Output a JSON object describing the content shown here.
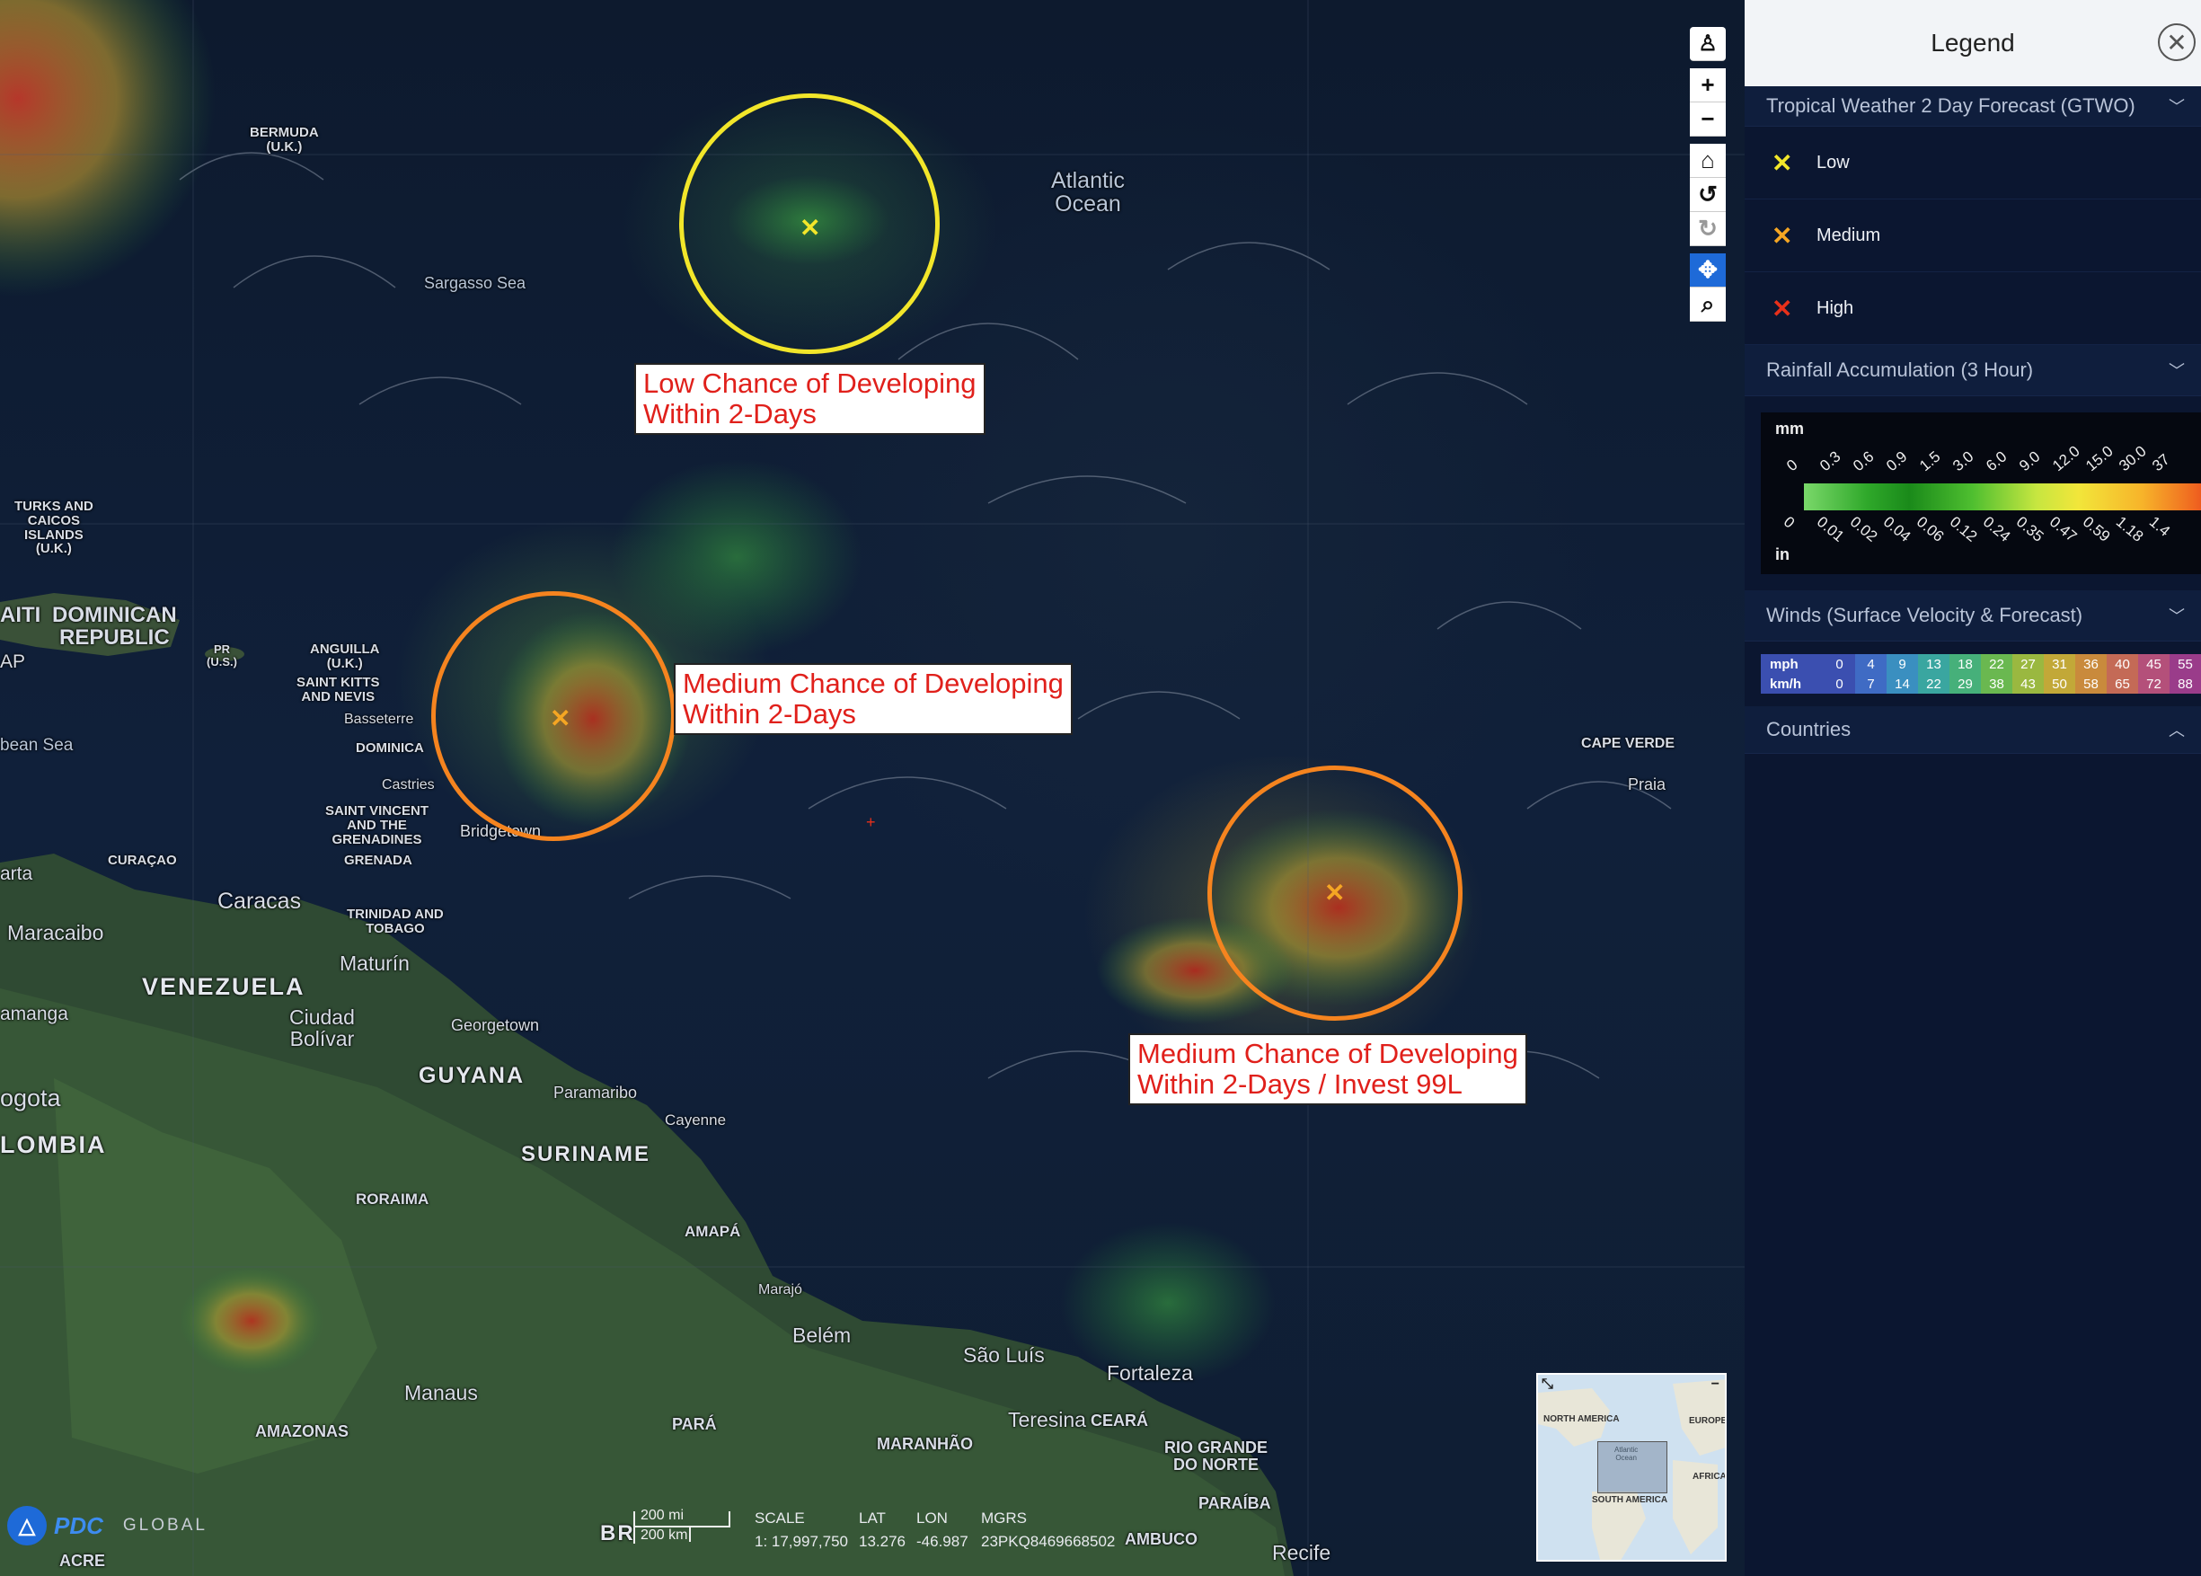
{
  "legend": {
    "title": "Legend",
    "sections": {
      "gtwo": {
        "title": "Tropical Weather 2 Day Forecast (GTWO)",
        "items": [
          {
            "label": "Low",
            "color": "#f2e62a"
          },
          {
            "label": "Medium",
            "color": "#f5a623"
          },
          {
            "label": "High",
            "color": "#e8301a"
          }
        ]
      },
      "rain": {
        "title": "Rainfall Accumulation (3 Hour)",
        "unit_top": "mm",
        "unit_bottom": "in",
        "mm_ticks": [
          "0",
          "0.3",
          "0.6",
          "0.9",
          "1.5",
          "3.0",
          "6.0",
          "9.0",
          "12.0",
          "15.0",
          "30.0",
          "37"
        ],
        "in_ticks": [
          "0",
          "0.01",
          "0.02",
          "0.04",
          "0.06",
          "0.12",
          "0.24",
          "0.35",
          "0.47",
          "0.59",
          "1.18",
          "1.4"
        ]
      },
      "winds": {
        "title": "Winds (Surface Velocity & Forecast)",
        "rows": [
          {
            "unit": "mph",
            "values": [
              "0",
              "4",
              "9",
              "13",
              "18",
              "22",
              "27",
              "31",
              "36",
              "40",
              "45",
              "55"
            ]
          },
          {
            "unit": "km/h",
            "values": [
              "0",
              "7",
              "14",
              "22",
              "29",
              "38",
              "43",
              "50",
              "58",
              "65",
              "72",
              "88"
            ]
          }
        ],
        "colors": [
          "#3b4fb0",
          "#3f6bc4",
          "#3a8fc0",
          "#3aa6a0",
          "#46b07a",
          "#6ab850",
          "#9ab840",
          "#c2a838",
          "#c98a3c",
          "#c46a56",
          "#b4507a",
          "#9a3c8a"
        ]
      },
      "countries": {
        "title": "Countries"
      }
    }
  },
  "callouts": [
    {
      "line1": "Low Chance of Developing",
      "line2": "Within 2-Days"
    },
    {
      "line1": "Medium Chance of Developing",
      "line2": "Within 2-Days"
    },
    {
      "line1": "Medium Chance of Developing",
      "line2": "Within 2-Days / Invest 99L"
    }
  ],
  "places": {
    "bermuda": "BERMUDA\n(U.K.)",
    "sargasso": "Sargasso Sea",
    "atlantic": "Atlantic\nOcean",
    "turks": "TURKS AND\nCAICOS\nISLANDS\n(U.K.)",
    "dominican": "DOMINICAN\nREPUBLIC",
    "aiti": "AITI",
    "pr": "PR\n(U.S.)",
    "ap": "AP",
    "anguilla": "ANGUILLA\n(U.K.)",
    "stkitts": "SAINT KITTS\nAND NEVIS",
    "basseterre": "Basseterre",
    "dominica": "DOMINICA",
    "castries": "Castries",
    "stvincent": "SAINT VINCENT\nAND THE\nGRENADINES",
    "grenada": "GRENADA",
    "bridgetown": "Bridgetown",
    "bean_sea": "bean Sea",
    "curacao": "CURAÇAO",
    "arta": "arta",
    "caracas": "Caracas",
    "maracaibo": "Maracaibo",
    "trinidad": "TRINIDAD AND\nTOBAGO",
    "maturin": "Maturín",
    "venezuela": "VENEZUELA",
    "amanga": "amanga",
    "ciudad": "Ciudad\nBolívar",
    "georgetown": "Georgetown",
    "guyana": "GUYANA",
    "paramaribo": "Paramaribo",
    "cayenne": "Cayenne",
    "ogota": "ogota",
    "olombia": "LOMBIA",
    "suriname": "SURINAME",
    "roraima": "RORAIMA",
    "amapa": "AMAPÁ",
    "marajo": "Marajó",
    "belem": "Belém",
    "saoluis": "São Luís",
    "fortaleza": "Fortaleza",
    "manaus": "Manaus",
    "amazonas": "AMAZONAS",
    "para": "PARÁ",
    "maranhao": "MARANHÃO",
    "teresina": "Teresina",
    "ceara": "CEARÁ",
    "riogrande": "RIO GRANDE\nDO NORTE",
    "paraiba": "PARAÍBA",
    "ambuco": "AMBUCO",
    "recife": "Recife",
    "acre": "ACRE",
    "br": "BR",
    "capeverde": "CAPE VERDE",
    "praia": "Praia"
  },
  "minimap": {
    "north_america": "NORTH AMERICA",
    "europe": "EUROPE",
    "africa": "AFRICA",
    "south_america": "SOUTH AMERICA",
    "atlantic": "Atlantic\nOcean"
  },
  "status": {
    "scale_mi": "200 mi",
    "scale_km": "200 km",
    "scale_label": "SCALE",
    "scale_value": "1: 17,997,750",
    "lat_label": "LAT",
    "lat_value": "13.276",
    "lon_label": "LON",
    "lon_value": "-46.987",
    "mgrs_label": "MGRS",
    "mgrs_value": "23PKQ8469668502"
  },
  "logo": {
    "brand": "PDC",
    "suffix": "GLOBAL"
  },
  "colors": {
    "low": "#f2e62a",
    "medium": "#f5841f",
    "accent": "#1e6ad8"
  }
}
